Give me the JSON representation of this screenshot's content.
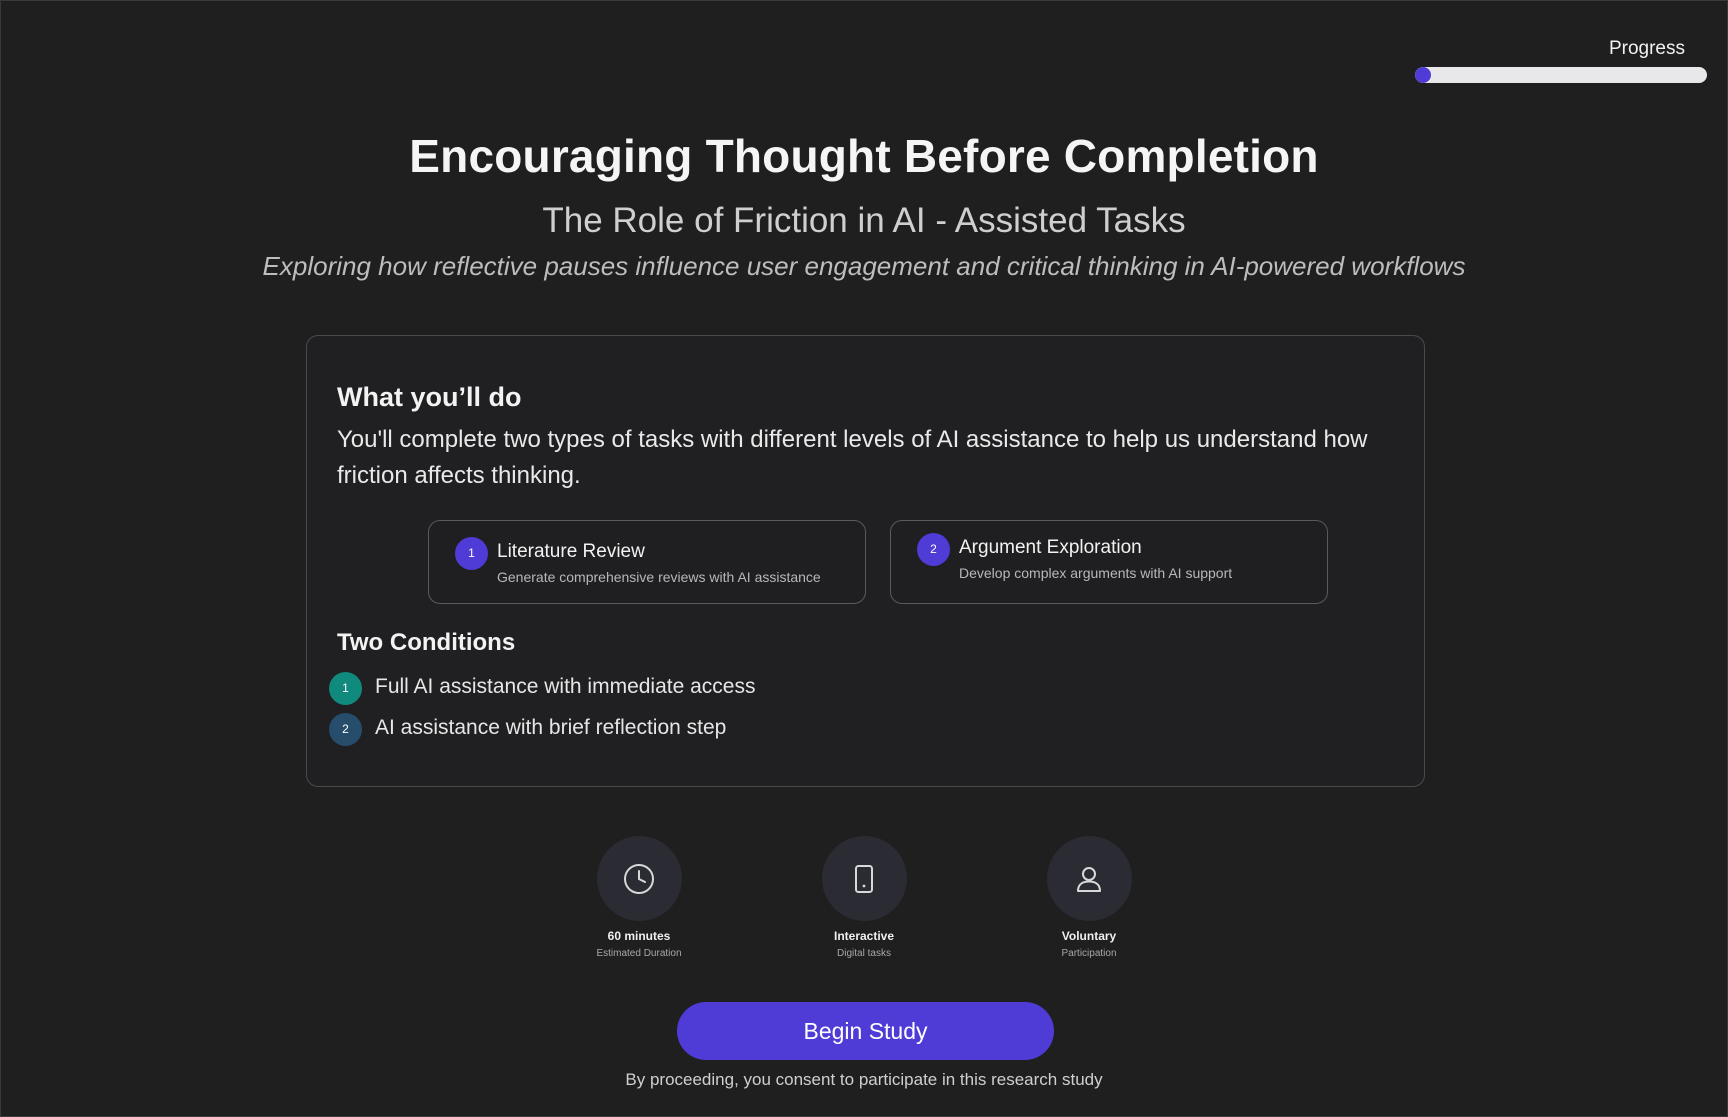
{
  "progress": {
    "label": "Progress",
    "fraction": 0.0,
    "fill_color": "#4f3bd6",
    "track_color": "#e8e8ea"
  },
  "header": {
    "title": "Encouraging Thought Before Completion",
    "subtitle": "The Role of Friction in AI - Assisted Tasks",
    "tagline": "Exploring how reflective pauses influence user engagement and critical thinking in AI-powered workflows"
  },
  "overview": {
    "heading": "What you’ll do",
    "description": "You'll complete two types of tasks with different levels of AI assistance to help us understand how friction affects thinking.",
    "tasks": [
      {
        "number": "1",
        "title": "Literature Review",
        "subtitle": "Generate comprehensive reviews with AI assistance"
      },
      {
        "number": "2",
        "title": "Argument Exploration",
        "subtitle": "Develop complex arguments with AI support"
      }
    ],
    "conditions_heading": "Two Conditions",
    "conditions": [
      {
        "number": "1",
        "text": "Full AI assistance with immediate access",
        "color": "#0f8a7d"
      },
      {
        "number": "2",
        "text": "AI assistance with brief reflection step",
        "color": "#264e6c"
      }
    ]
  },
  "info": [
    {
      "icon": "clock-icon",
      "label": "60 minutes",
      "sub": "Estimated Duration"
    },
    {
      "icon": "tablet-icon",
      "label": "Interactive",
      "sub": "Digital tasks"
    },
    {
      "icon": "user-icon",
      "label": "Voluntary",
      "sub": "Participation"
    }
  ],
  "actions": {
    "begin_label": "Begin Study",
    "consent_text": "By proceeding, you consent to participate in this research study"
  },
  "colors": {
    "background": "#1f1f20",
    "accent": "#4f3bd6"
  }
}
